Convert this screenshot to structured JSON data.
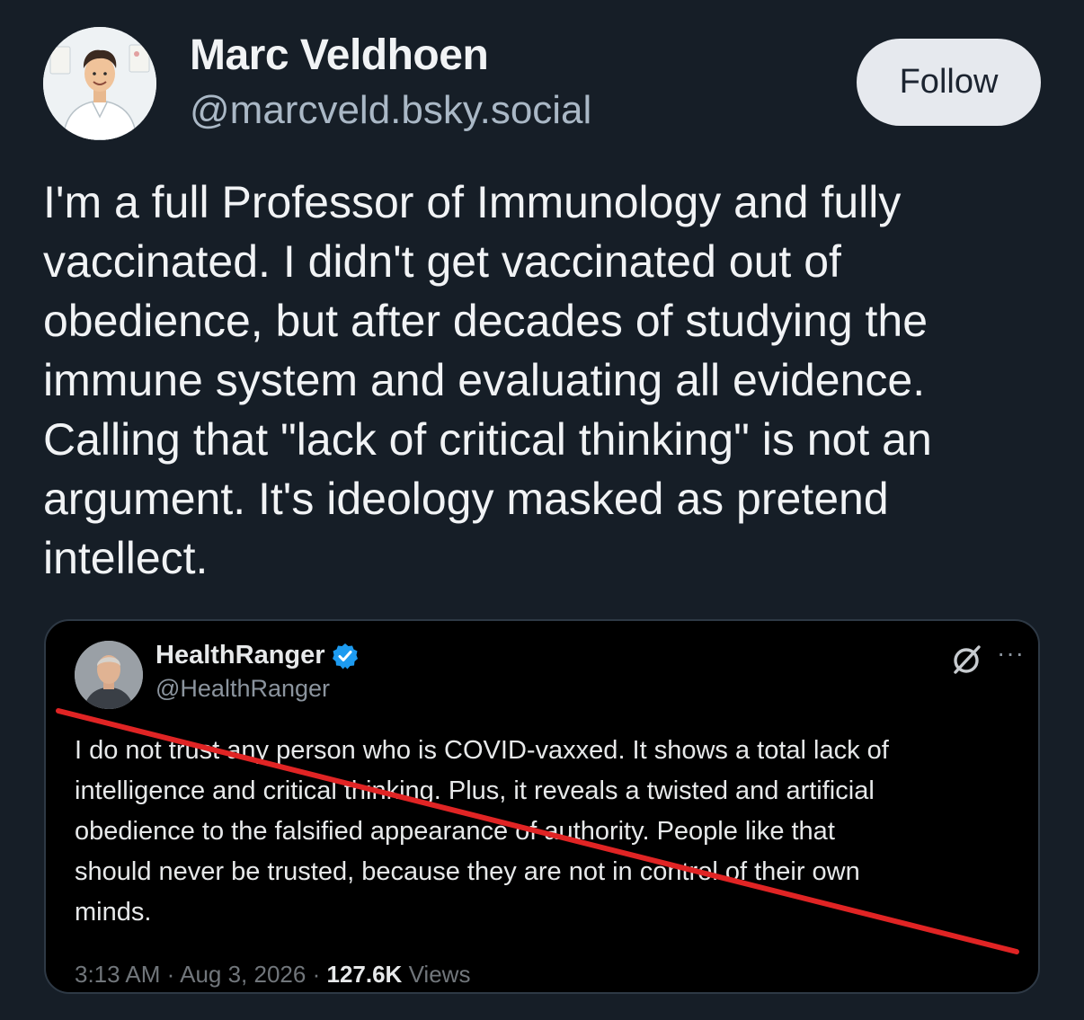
{
  "author": {
    "display_name": "Marc Veldhoen",
    "handle": "@marcveld.bsky.social"
  },
  "follow_button": {
    "label": "Follow"
  },
  "post": {
    "text": "I'm a full Professor of Immunology and fully\nvaccinated. I didn't get vaccinated out of\nobedience, but after decades of studying the\nimmune system and evaluating all evidence.\nCalling that \"lack of critical thinking\" is not an\nargument. It's ideology masked as pretend\nintellect."
  },
  "embed": {
    "name": "HealthRanger",
    "handle": "@HealthRanger",
    "text": "I do not trust any person who is COVID-vaxxed. It shows a total lack of\nintelligence and critical thinking. Plus, it reveals a twisted and artificial\nobedience to the falsified appearance of authority. People like that\nshould never be trusted, because they are not in control of their own\nminds.",
    "time": "3:13 AM",
    "date": "Aug 3, 2026",
    "separator": "·",
    "views_count": "127.6K",
    "views_label": "Views",
    "verified_color": "#1d9bf0",
    "strike_color": "#e02424"
  },
  "colors": {
    "background": "#161e27",
    "text": "#f1f3f5",
    "handle": "#aab8c6",
    "button_bg": "#e6e9ee"
  },
  "icons": {
    "embed_logo": "grok-slash-circle-icon",
    "embed_more": "more-horizontal-icon",
    "verified": "verified-badge-icon"
  }
}
